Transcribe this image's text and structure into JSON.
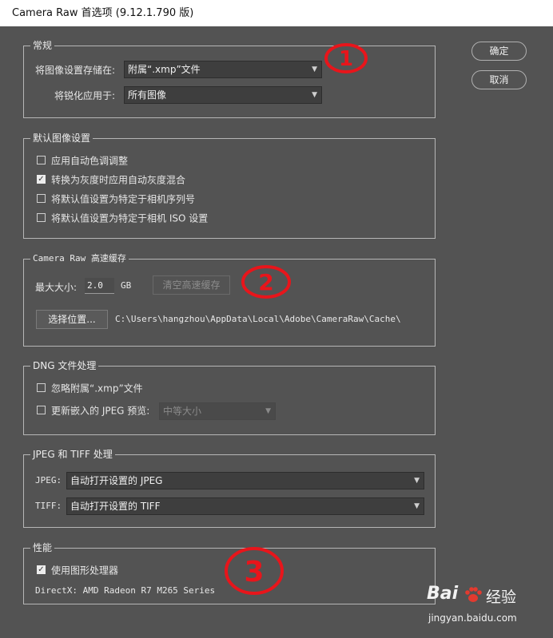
{
  "window": {
    "title": "Camera Raw 首选项 (9.12.1.790 版)"
  },
  "buttons": {
    "ok": "确定",
    "cancel": "取消"
  },
  "general": {
    "legend": "常规",
    "save_settings_label": "将图像设置存储在:",
    "save_settings_value": "附属“.xmp”文件",
    "sharpening_label": "将锐化应用于:",
    "sharpening_value": "所有图像"
  },
  "defaults": {
    "legend": "默认图像设置",
    "items": [
      {
        "label": "应用自动色调调整",
        "checked": false
      },
      {
        "label": "转换为灰度时应用自动灰度混合",
        "checked": true
      },
      {
        "label": "将默认值设置为特定于相机序列号",
        "checked": false
      },
      {
        "label": "将默认值设置为特定于相机 ISO 设置",
        "checked": false
      }
    ]
  },
  "cache": {
    "legend": "Camera Raw 高速缓存",
    "max_size_label": "最大大小:",
    "max_size_value": "2.0",
    "unit": "GB",
    "purge_button": "清空高速缓存",
    "select_location_button": "选择位置...",
    "path": "C:\\Users\\hangzhou\\AppData\\Local\\Adobe\\CameraRaw\\Cache\\"
  },
  "dng": {
    "legend": "DNG 文件处理",
    "ignore_sidecar_label": "忽略附属“.xmp”文件",
    "ignore_sidecar_checked": false,
    "update_preview_label": "更新嵌入的 JPEG 预览:",
    "update_preview_checked": false,
    "preview_size_value": "中等大小"
  },
  "jpeg_tiff": {
    "legend": "JPEG 和 TIFF 处理",
    "jpeg_label": "JPEG:",
    "jpeg_value": "自动打开设置的 JPEG",
    "tiff_label": "TIFF:",
    "tiff_value": "自动打开设置的 TIFF"
  },
  "performance": {
    "legend": "性能",
    "gpu_label": "使用图形处理器",
    "gpu_checked": true,
    "directx_info": "DirectX: AMD Radeon R7 M265 Series"
  },
  "annotations": {
    "one": "1",
    "two": "2",
    "three": "3",
    "color": "#e8151b"
  },
  "watermark": {
    "brand": "Bai",
    "brand_cn": "经验",
    "url": "jingyan.baidu.com"
  }
}
